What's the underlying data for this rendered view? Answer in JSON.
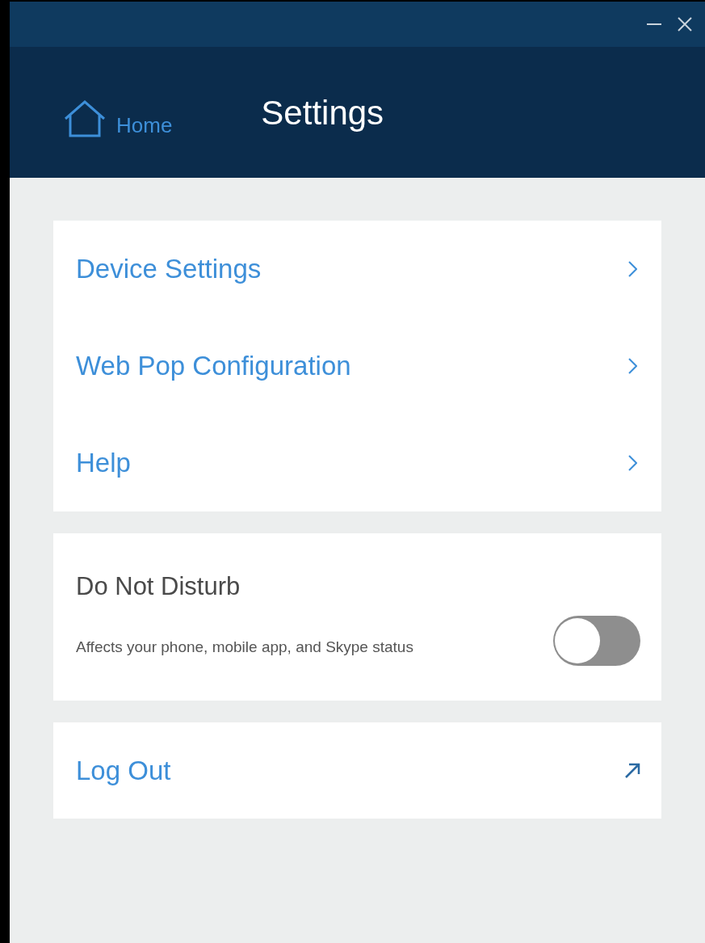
{
  "header": {
    "home_label": "Home",
    "title": "Settings"
  },
  "nav_items": [
    {
      "label": "Device Settings"
    },
    {
      "label": "Web Pop Configuration"
    },
    {
      "label": "Help"
    }
  ],
  "do_not_disturb": {
    "title": "Do Not Disturb",
    "description": "Affects your phone, mobile app, and Skype status",
    "on": false
  },
  "logout": {
    "label": "Log Out"
  }
}
